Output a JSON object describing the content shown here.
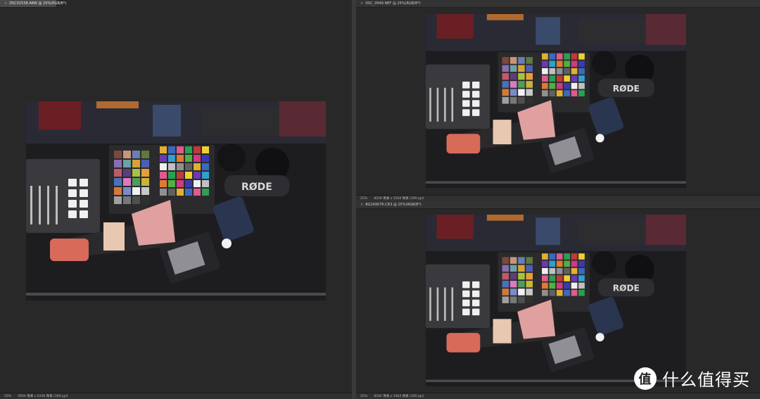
{
  "panels": [
    {
      "tab": "DSC02538.ARW @ 25%(RGB/8*)",
      "zoom": "25%",
      "info": "9504 像素 x 6336 像素 (300 ppi)"
    },
    {
      "tab": "DSC_0949.NEF @ 25%(RGB/8*)",
      "zoom": "25%",
      "info": "8256 像素 x 5504 像素 (300 ppi)"
    },
    {
      "tab": "8G2A9076.CR3 @ 25%(RGB/8*)",
      "zoom": "25%",
      "info": "8192 像素 x 5464 像素 (300 ppi)"
    }
  ],
  "scene": {
    "brand_mic": "RØDE"
  },
  "watermark": {
    "logo": "值",
    "text": "什么值得买"
  },
  "colors": {
    "panel_bg": "#282828",
    "tab_bg": "#4a4a4a",
    "divider": "#3a3a3a"
  }
}
